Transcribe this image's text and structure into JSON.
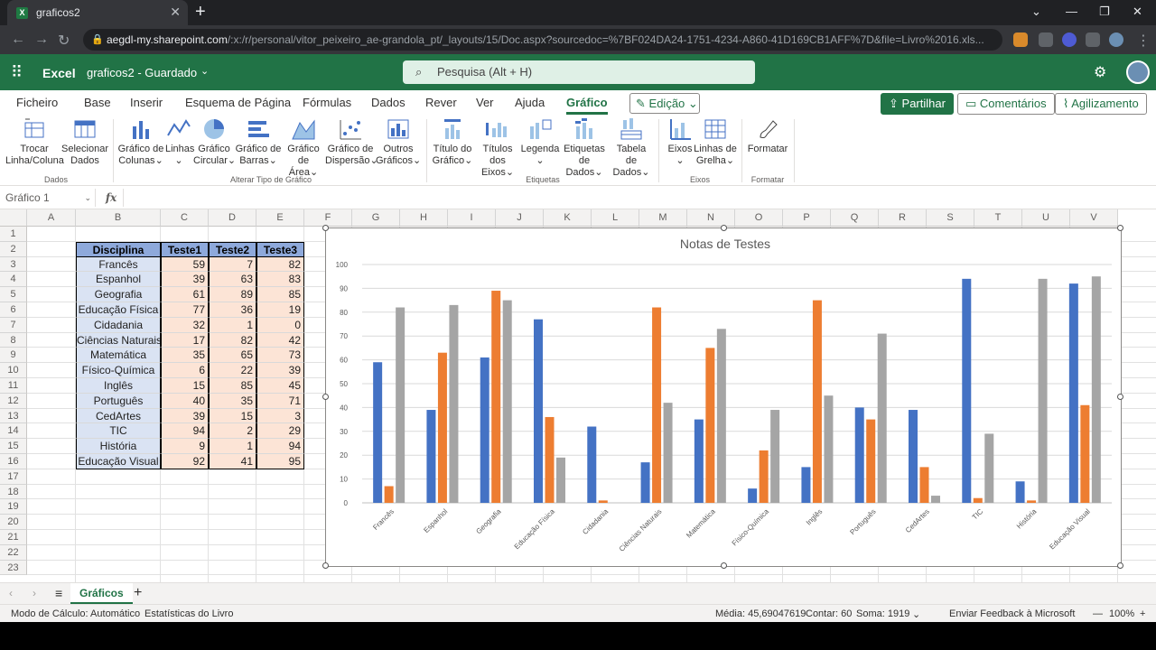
{
  "browser": {
    "tab_title": "graficos2",
    "url_domain": "aegdl-my.sharepoint.com",
    "url_path": "/:x:/r/personal/vitor_peixeiro_ae-grandola_pt/_layouts/15/Doc.aspx?sourcedoc=%7BF024DA24-1751-4234-A860-41D169CB1AFF%7D&file=Livro%2016.xls..."
  },
  "excel": {
    "app_name": "Excel",
    "doc_name": "graficos2 - Guardado",
    "search_placeholder": "Pesquisa (Alt + H)",
    "accent": "#217346"
  },
  "ribbon_tabs": [
    "Ficheiro",
    "Base",
    "Inserir",
    "Esquema de Página",
    "Fórmulas",
    "Dados",
    "Rever",
    "Ver",
    "Ajuda",
    "Gráfico"
  ],
  "active_tab": "Gráfico",
  "edit_mode": "Edição",
  "header_buttons": {
    "share": "Partilhar",
    "comments": "Comentários",
    "catchup": "Agilizamento"
  },
  "ribbon": {
    "switch": [
      "Trocar",
      "Linha/Coluna"
    ],
    "select_data": [
      "Selecionar",
      "Dados"
    ],
    "col_chart": [
      "Gráfico de",
      "Colunas"
    ],
    "lines": [
      "Linhas",
      ""
    ],
    "pie": [
      "Gráfico",
      "Circular"
    ],
    "bar": [
      "Gráfico de",
      "Barras"
    ],
    "area": [
      "Gráfico de",
      "Área"
    ],
    "scatter": [
      "Gráfico de",
      "Dispersão"
    ],
    "other": [
      "Outros",
      "Gráficos"
    ],
    "chart_title": [
      "Título do",
      "Gráfico"
    ],
    "axis_titles": [
      "Títulos dos",
      "Eixos"
    ],
    "legend": [
      "Legenda",
      ""
    ],
    "data_labels": [
      "Etiquetas de",
      "Dados"
    ],
    "data_table": [
      "Tabela de",
      "Dados"
    ],
    "axes": [
      "Eixos",
      ""
    ],
    "gridlines": [
      "Linhas de",
      "Grelha"
    ],
    "format": [
      "Formatar",
      ""
    ],
    "groups": {
      "dados": "Dados",
      "tipo": "Alterar Tipo de Gráfico",
      "etiquetas": "Etiquetas",
      "eixos": "Eixos",
      "formatar": "Formatar"
    }
  },
  "formula_bar": {
    "name_box": "Gráfico 1",
    "fx": "fx"
  },
  "columns": [
    "A",
    "B",
    "C",
    "D",
    "E",
    "F",
    "G",
    "H",
    "I",
    "J",
    "K",
    "L",
    "M",
    "N",
    "O",
    "P",
    "Q",
    "R",
    "S",
    "T",
    "U",
    "V"
  ],
  "rows": [
    "1",
    "2",
    "3",
    "4",
    "5",
    "6",
    "7",
    "8",
    "9",
    "10",
    "11",
    "12",
    "13",
    "14",
    "15",
    "16",
    "17",
    "18",
    "19",
    "20",
    "21",
    "22",
    "23"
  ],
  "table": {
    "headers": [
      "Disciplina",
      "Teste1",
      "Teste2",
      "Teste3"
    ],
    "rows": [
      [
        "Francês",
        59,
        7,
        82
      ],
      [
        "Espanhol",
        39,
        63,
        83
      ],
      [
        "Geografia",
        61,
        89,
        85
      ],
      [
        "Educação Física",
        77,
        36,
        19
      ],
      [
        "Cidadania",
        32,
        1,
        0
      ],
      [
        "Ciências Naturais",
        17,
        82,
        42
      ],
      [
        "Matemática",
        35,
        65,
        73
      ],
      [
        "Físico-Química",
        6,
        22,
        39
      ],
      [
        "Inglês",
        15,
        85,
        45
      ],
      [
        "Português",
        40,
        35,
        71
      ],
      [
        "CedArtes",
        39,
        15,
        3
      ],
      [
        "TIC",
        94,
        2,
        29
      ],
      [
        "História",
        9,
        1,
        94
      ],
      [
        "Educação Visual",
        92,
        41,
        95
      ]
    ]
  },
  "chart_data": {
    "type": "bar",
    "title": "Notas de Testes",
    "categories": [
      "Francês",
      "Espanhol",
      "Geografia",
      "Educação Física",
      "Cidadania",
      "Ciências Naturais",
      "Matemática",
      "Físico-Química",
      "Inglês",
      "Português",
      "CedArtes",
      "TIC",
      "História",
      "Educação Visual"
    ],
    "series": [
      {
        "values": [
          59,
          39,
          61,
          77,
          32,
          17,
          35,
          6,
          15,
          40,
          39,
          94,
          9,
          92
        ],
        "color": "#4472c4"
      },
      {
        "values": [
          7,
          63,
          89,
          36,
          1,
          82,
          65,
          22,
          85,
          35,
          15,
          2,
          1,
          41
        ],
        "color": "#ed7d31"
      },
      {
        "values": [
          82,
          83,
          85,
          19,
          0,
          42,
          73,
          39,
          45,
          71,
          3,
          29,
          94,
          95
        ],
        "color": "#a5a5a5"
      }
    ],
    "ylim": [
      0,
      100
    ],
    "yticks": [
      0,
      10,
      20,
      30,
      40,
      50,
      60,
      70,
      80,
      90,
      100
    ],
    "grid": true,
    "legend": "none"
  },
  "sheets": [
    "Gráficos"
  ],
  "status": {
    "calc_mode": "Modo de Cálculo: Automático",
    "stats": "Estatísticas do Livro",
    "average": "Média: 45,69047619",
    "count": "Contar: 60",
    "sum": "Soma: 1919",
    "feedback": "Enviar Feedback à Microsoft",
    "zoom": "100%"
  }
}
